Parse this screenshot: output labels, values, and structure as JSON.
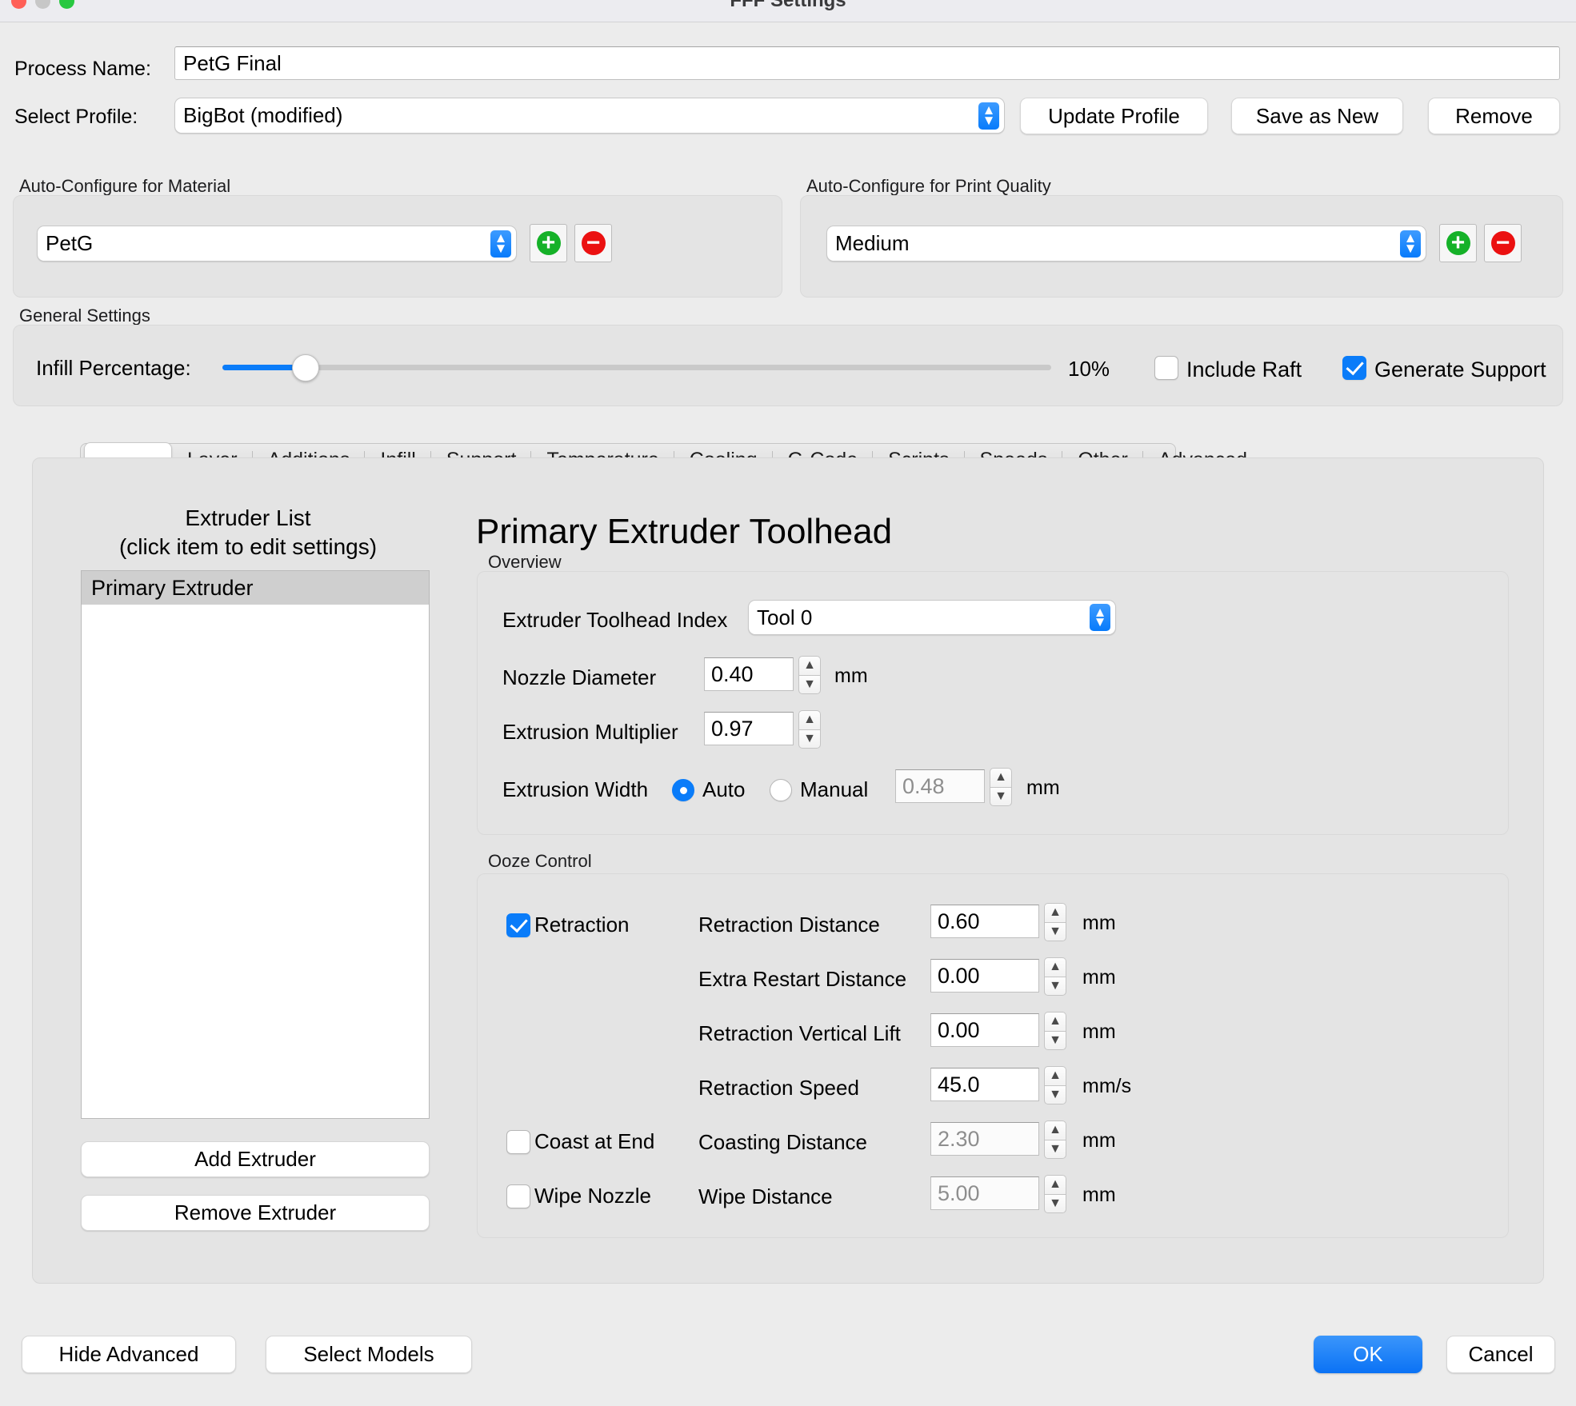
{
  "window": {
    "title": "FFF Settings",
    "traffic_lights": [
      "close",
      "minimize",
      "zoom"
    ]
  },
  "header": {
    "process_name_label": "Process Name:",
    "process_name_value": "PetG Final",
    "select_profile_label": "Select Profile:",
    "select_profile_value": "BigBot (modified)",
    "buttons": [
      {
        "label": "Update Profile",
        "name": "update-profile-button"
      },
      {
        "label": "Save as New",
        "name": "save-as-new-button"
      },
      {
        "label": "Remove",
        "name": "remove-profile-button"
      }
    ]
  },
  "material_group": {
    "title": "Auto-Configure for Material",
    "value": "PetG",
    "add_label": "+",
    "remove_label": "−"
  },
  "quality_group": {
    "title": "Auto-Configure for Print Quality",
    "value": "Medium",
    "add_label": "+",
    "remove_label": "−"
  },
  "general_settings": {
    "title": "General Settings",
    "infill_label": "Infill Percentage:",
    "infill_value": "10%",
    "infill_percent": 10,
    "include_raft_label": "Include Raft",
    "include_raft_checked": false,
    "generate_support_label": "Generate Support",
    "generate_support_checked": true
  },
  "tabs": [
    {
      "label": "",
      "active": true
    },
    {
      "label": "Layer",
      "active": false
    },
    {
      "label": "Additions",
      "active": false
    },
    {
      "label": "Infill",
      "active": false
    },
    {
      "label": "Support",
      "active": false
    },
    {
      "label": "Temperature",
      "active": false
    },
    {
      "label": "Cooling",
      "active": false
    },
    {
      "label": "G-Code",
      "active": false
    },
    {
      "label": "Scripts",
      "active": false
    },
    {
      "label": "Speeds",
      "active": false
    },
    {
      "label": "Other",
      "active": false
    },
    {
      "label": "Advanced",
      "active": false
    }
  ],
  "extruder_list": {
    "title_line1": "Extruder List",
    "title_line2": "(click item to edit settings)",
    "items": [
      {
        "label": "Primary Extruder",
        "selected": true
      }
    ],
    "add_button": "Add Extruder",
    "remove_button": "Remove Extruder"
  },
  "extruder_panel": {
    "heading": "Primary Extruder Toolhead",
    "overview": {
      "title": "Overview",
      "toolhead_index_label": "Extruder Toolhead Index",
      "toolhead_index_value": "Tool 0",
      "nozzle_diameter_label": "Nozzle Diameter",
      "nozzle_diameter_value": "0.40",
      "nozzle_diameter_unit": "mm",
      "extrusion_multiplier_label": "Extrusion Multiplier",
      "extrusion_multiplier_value": "0.97",
      "extrusion_width_label": "Extrusion Width",
      "extrusion_width_auto_label": "Auto",
      "extrusion_width_manual_label": "Manual",
      "extrusion_width_mode": "Auto",
      "extrusion_width_value": "0.48",
      "extrusion_width_unit": "mm",
      "multiplier_unit": ""
    },
    "ooze_control": {
      "title": "Ooze Control",
      "retraction_label": "Retraction",
      "retraction_checked": true,
      "coast_at_end_label": "Coast at End",
      "coast_at_end_checked": false,
      "wipe_nozzle_label": "Wipe Nozzle",
      "wipe_nozzle_checked": false,
      "rows": [
        {
          "label": "Retraction Distance",
          "value": "0.60",
          "unit": "mm",
          "disabled": false
        },
        {
          "label": "Extra Restart Distance",
          "value": "0.00",
          "unit": "mm",
          "disabled": false
        },
        {
          "label": "Retraction Vertical Lift",
          "value": "0.00",
          "unit": "mm",
          "disabled": false
        },
        {
          "label": "Retraction Speed",
          "value": "45.0",
          "unit": "mm/s",
          "disabled": false
        },
        {
          "label": "Coasting Distance",
          "value": "2.30",
          "unit": "mm",
          "disabled": true
        },
        {
          "label": "Wipe Distance",
          "value": "5.00",
          "unit": "mm",
          "disabled": true
        }
      ]
    }
  },
  "footer": {
    "hide_advanced": "Hide Advanced",
    "select_models": "Select Models",
    "ok": "OK",
    "cancel": "Cancel"
  },
  "colors": {
    "accent_blue": "#0a7cf9",
    "green": "#15b128",
    "red": "#eb1111",
    "window_bg": "#ececec"
  }
}
